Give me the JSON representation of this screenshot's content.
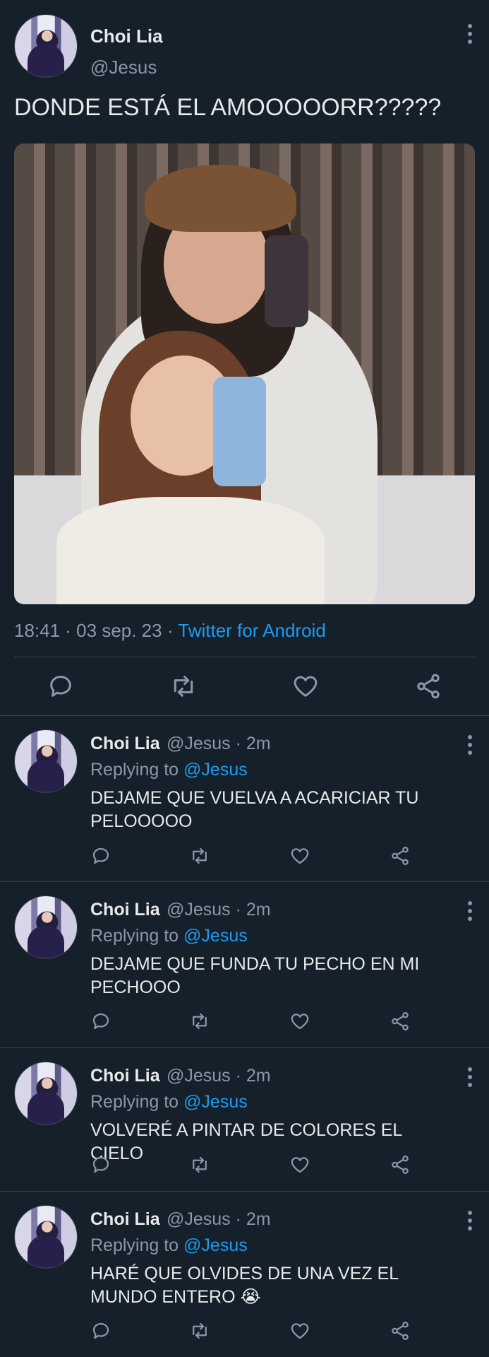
{
  "tweet": {
    "author_name": "Choi Lia",
    "author_handle": "@Jesus",
    "text": "DONDE ESTÁ EL AMOOOOORR?????",
    "time": "18:41 · 03 sep. 23 · ",
    "source": "Twitter for Android"
  },
  "actions": [
    "reply-icon",
    "retweet-icon",
    "like-icon",
    "share-icon"
  ],
  "replies": [
    {
      "name": "Choi Lia",
      "handle_time": "@Jesus · 2m",
      "replying_prefix": "Replying to ",
      "replying_to": "@Jesus",
      "text": "DEJAME QUE VUELVA A ACARICIAR TU PELOOOOO"
    },
    {
      "name": "Choi Lia",
      "handle_time": "@Jesus · 2m",
      "replying_prefix": "Replying to ",
      "replying_to": "@Jesus",
      "text": "DEJAME QUE FUNDA TU PECHO EN MI PECHOOO"
    },
    {
      "name": "Choi Lia",
      "handle_time": "@Jesus · 2m",
      "replying_prefix": "Replying to ",
      "replying_to": "@Jesus",
      "text": "VOLVERÉ A PINTAR DE COLORES EL CIELO"
    },
    {
      "name": "Choi Lia",
      "handle_time": "@Jesus · 2m",
      "replying_prefix": "Replying to ",
      "replying_to": "@Jesus",
      "text": "HARÉ QUE OLVIDES DE UNA VEZ EL MUNDO ENTERO 😭"
    }
  ],
  "colors": {
    "background": "#15202b",
    "text": "#e7e9ea",
    "secondary": "#8b98a5",
    "link": "#1d9bf0",
    "divider": "#38444d"
  }
}
